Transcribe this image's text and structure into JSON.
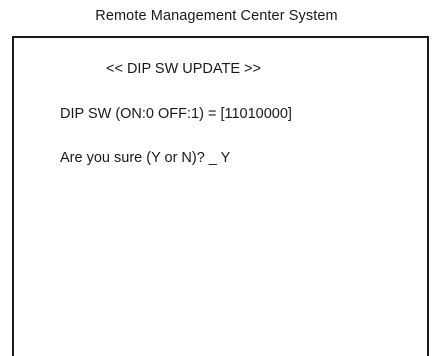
{
  "header": {
    "title": "Remote Management Center System"
  },
  "terminal": {
    "heading": "<< DIP SW UPDATE >>",
    "dip_sw_line": "DIP SW (ON:0 OFF:1) = [11010000]",
    "confirm_prompt": "Are you sure (Y or N)? _ Y"
  }
}
